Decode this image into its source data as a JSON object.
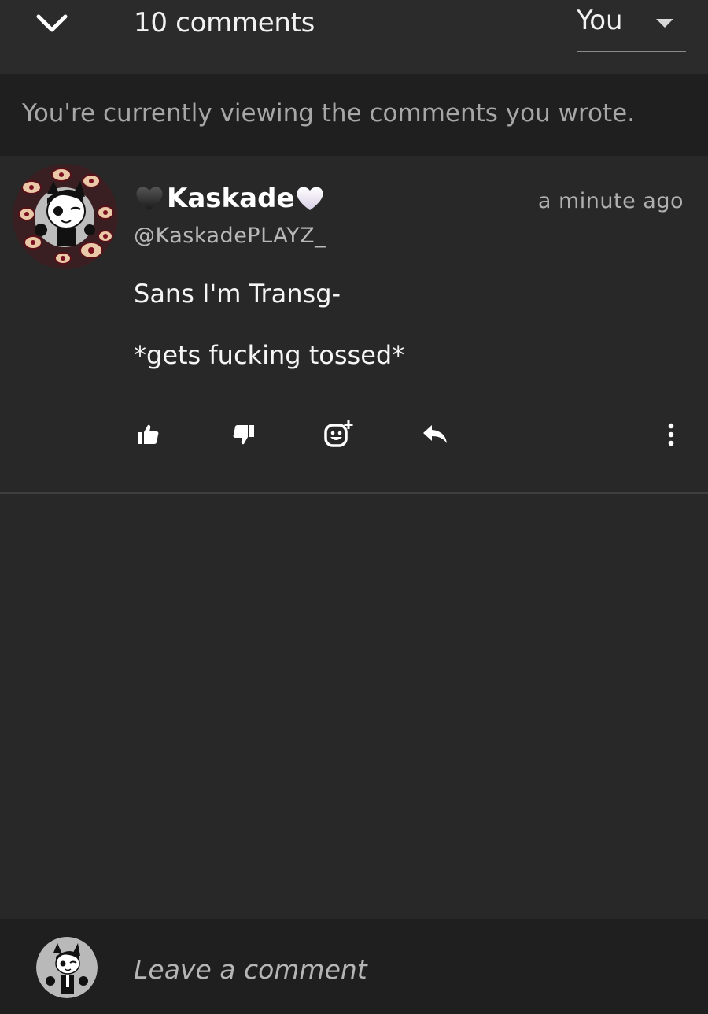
{
  "header": {
    "comment_count_label": "10 comments",
    "filter": {
      "selected": "You"
    }
  },
  "notice": {
    "text": "You're currently viewing the comments you wrote."
  },
  "comment": {
    "display_name": "Kaskade",
    "handle": "@KaskadePLAYZ_",
    "timestamp": "a minute ago",
    "body_lines": [
      "Sans I'm Transg-",
      "*gets fucking tossed*"
    ],
    "icons": {
      "left_heart": "black-heart-icon",
      "right_heart": "white-heart-icon",
      "actions": [
        "thumbs-up-icon",
        "thumbs-down-icon",
        "add-sticker-icon",
        "reply-icon",
        "more-options-icon"
      ]
    }
  },
  "composer": {
    "placeholder": "Leave a comment"
  },
  "colors": {
    "background": "#282828",
    "header": "#2b2b2b",
    "notice_bar": "#1f1f1f",
    "text_primary": "#ffffff",
    "text_secondary": "#b0b0b0"
  }
}
